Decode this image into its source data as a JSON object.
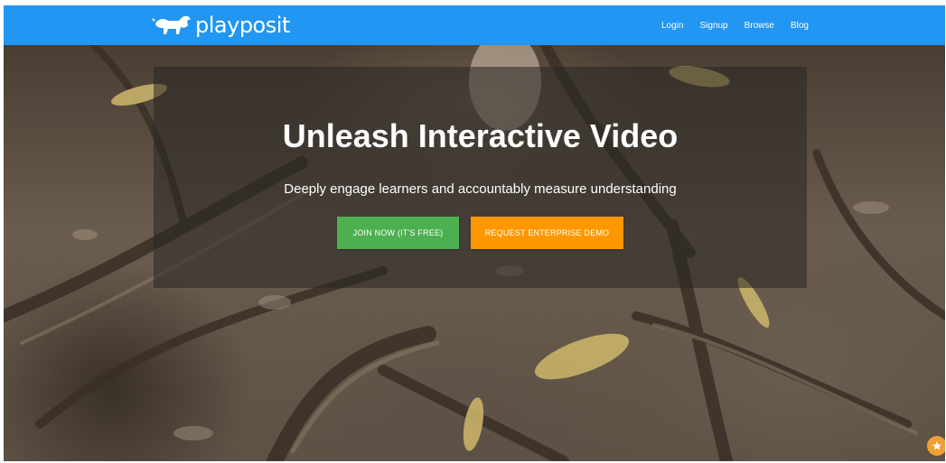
{
  "brand": {
    "name": "playposit",
    "logo_icon": "dog-logo-icon"
  },
  "nav": {
    "items": [
      {
        "label": "Login"
      },
      {
        "label": "Signup"
      },
      {
        "label": "Browse"
      },
      {
        "label": "Blog"
      }
    ]
  },
  "hero": {
    "title": "Unleash Interactive Video",
    "subtitle": "Deeply engage learners and accountably measure understanding",
    "join_button": "JOIN NOW (IT'S FREE)",
    "demo_button": "REQUEST ENTERPRISE DEMO"
  },
  "floating_action": {
    "icon": "star-icon"
  },
  "colors": {
    "nav_bar": "#2196f3",
    "join_button": "#4caf50",
    "demo_button": "#ff9800",
    "fab": "#f0a030"
  }
}
